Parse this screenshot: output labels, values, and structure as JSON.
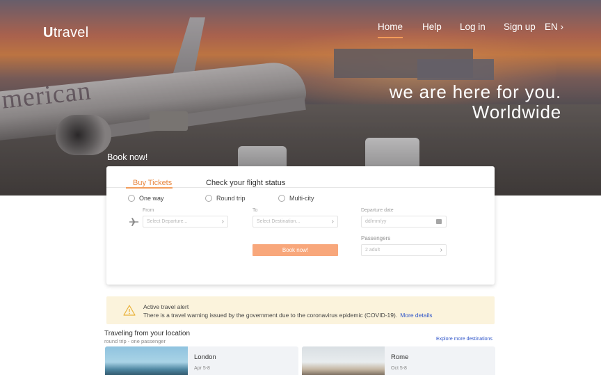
{
  "brand": {
    "logo_initial": "U",
    "logo_rest": "travel"
  },
  "nav": {
    "home": "Home",
    "help": "Help",
    "login": "Log in",
    "signup": "Sign up",
    "language": "EN"
  },
  "hero": {
    "tagline_line1": "we are here for you.",
    "tagline_line2": "Worldwide",
    "book_now_label": "Book now!",
    "plane_livery_text": "merican"
  },
  "booking": {
    "tabs": [
      "Buy Tickets",
      "Check your flight status"
    ],
    "active_tab": "Buy Tickets",
    "trip_types": [
      "One way",
      "Round trip",
      "Multi-city"
    ],
    "from_label": "From",
    "from_placeholder": "Select Departure...",
    "to_label": "To",
    "to_placeholder": "Select Destination...",
    "date_label": "Departure date",
    "date_placeholder": "dd/mm/yy",
    "passengers_label": "Passengers",
    "passengers_value": "2 adult",
    "submit_label": "Book now!"
  },
  "alert": {
    "title": "Active travel alert",
    "body": "There is a travel warning issued by the government due to the coronavirus epidemic (COVID-19).",
    "link": "More details"
  },
  "travel": {
    "title": "Traveling from your location",
    "subtitle": "round trip - one passenger",
    "explore_link": "Explore more destinations",
    "destinations": [
      {
        "city": "London",
        "dates": "Apr 5-8"
      },
      {
        "city": "Rome",
        "dates": "Oct 5-8"
      }
    ]
  },
  "colors": {
    "accent": "#f39c5a",
    "accent_text": "#e8853c",
    "button_bg": "#f8a77b",
    "link": "#2f55c9",
    "alert_bg": "#fbf3dc"
  }
}
